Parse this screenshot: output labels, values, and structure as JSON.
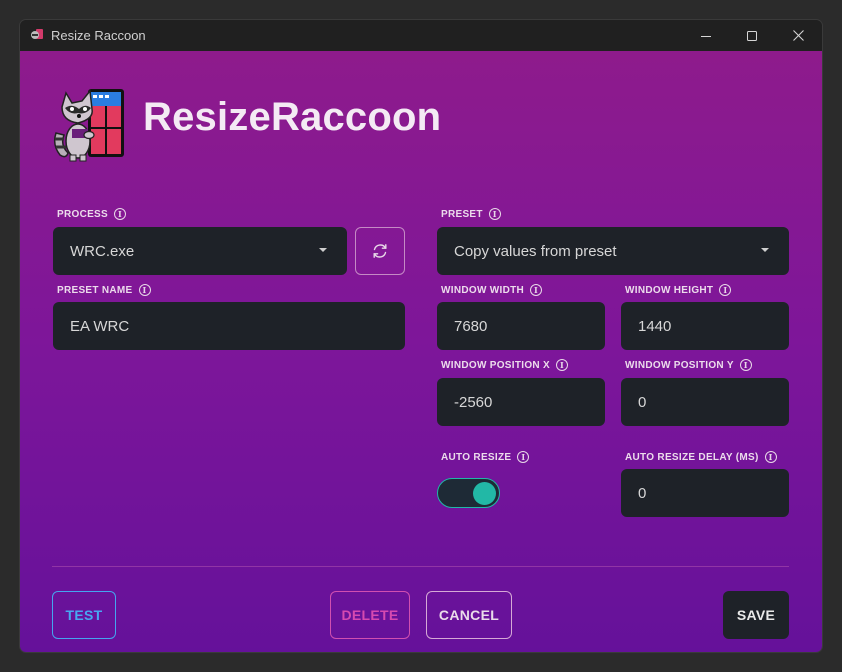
{
  "window": {
    "title": "Resize Raccoon",
    "controls": [
      "minimize-icon",
      "maximize-icon",
      "close-icon"
    ]
  },
  "brand": {
    "name": "ResizeRaccoon"
  },
  "form": {
    "process": {
      "label": "PROCESS",
      "value": "WRC.exe"
    },
    "preset": {
      "label": "PRESET",
      "value": "Copy values from preset"
    },
    "preset_name": {
      "label": "PRESET NAME",
      "value": "EA WRC"
    },
    "window_width": {
      "label": "WINDOW WIDTH",
      "value": "7680"
    },
    "window_height": {
      "label": "WINDOW HEIGHT",
      "value": "1440"
    },
    "window_position_x": {
      "label": "WINDOW POSITION X",
      "value": "-2560"
    },
    "window_position_y": {
      "label": "WINDOW POSITION Y",
      "value": "0"
    },
    "auto_resize": {
      "label": "AUTO RESIZE",
      "enabled": true
    },
    "auto_resize_delay": {
      "label": "AUTO RESIZE DELAY (MS)",
      "value": "0"
    }
  },
  "buttons": {
    "test": "TEST",
    "delete": "DELETE",
    "cancel": "CANCEL",
    "save": "SAVE"
  },
  "colors": {
    "accent_teal": "#22b8a6",
    "test_blue": "#47a7f2",
    "delete_pink": "#d64ab0",
    "field_bg": "#1e2228"
  }
}
